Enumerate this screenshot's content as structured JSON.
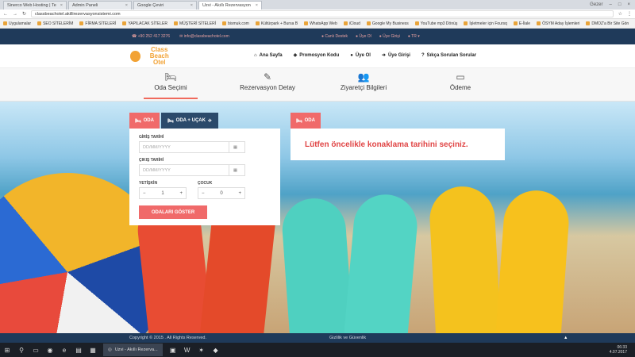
{
  "browser": {
    "tabs": [
      {
        "label": "Sinerco Web Hosting | Te",
        "active": false
      },
      {
        "label": "Admin Paneli",
        "active": false
      },
      {
        "label": "Google Çeviri",
        "active": false
      },
      {
        "label": "Uzvi - Akıllı Rezervasyon",
        "active": true
      }
    ],
    "profile": "Gezer",
    "url": "classbeachotel.akillirezervasyonsistemi.com",
    "bookmarks": [
      "Uygulamalar",
      "SEO SİTELERİM",
      "FİRMA SİTELERİ",
      "YAPILACAK SİTELER",
      "MÜŞTERİ SİTELERİ",
      "bismuk.com",
      "Kültürpark + Bursa B",
      "WhatsApp Web",
      "iCloud",
      "Google My Business",
      "YouTube mp3 Dönüş",
      "İşletmeler için Foursq",
      "E-İlale",
      "ÖSYM Aday İşlemleri",
      "DMOZ'a Bir Site Gön"
    ]
  },
  "topbar": {
    "phone": "+90 252 417 3276",
    "email": "info@classbeachotel.com",
    "live_support": "Canlı Destek",
    "signup": "Üye Ol",
    "login": "Üye Girişi",
    "lang": "TR"
  },
  "brand": {
    "line1": "Class Beach",
    "line2": "Otel"
  },
  "menu": {
    "home": "Ana Sayfa",
    "promo": "Promosyon Kodu",
    "member": "Üye Ol",
    "member_login": "Üye Girişi",
    "faq": "Sıkça Sorulan Sorular"
  },
  "steps": [
    {
      "label": "Oda Seçimi",
      "icon": "bed-icon",
      "active": true
    },
    {
      "label": "Rezervasyon Detay",
      "icon": "edit-icon",
      "active": false
    },
    {
      "label": "Ziyaretçi Bilgileri",
      "icon": "users-icon",
      "active": false
    },
    {
      "label": "Ödeme",
      "icon": "credit-card-icon",
      "active": false
    }
  ],
  "booking": {
    "tab_room": "ODA",
    "tab_room_flight": "ODA + UÇAK",
    "checkin_label": "GİRİŞ TARİHİ",
    "checkin_placeholder": "DD/MM/YYYY",
    "checkout_label": "ÇIKIŞ TARİHİ",
    "checkout_placeholder": "DD/MM/YYYY",
    "adult_label": "YETİŞKİN",
    "adult_value": "1",
    "child_label": "ÇOCUK",
    "child_value": "0",
    "submit": "ODALARI GÖSTER"
  },
  "notice": {
    "tab": "ODA",
    "message": "Lütfen öncelikle konaklama tarihini seçiniz."
  },
  "footer": {
    "copyright": "Copyright © 2015 . All Rights Reserved.",
    "privacy": "Gizlilik ve Güvenlik",
    "back_top": "▲"
  },
  "taskbar": {
    "active_app": "Uzvi - Akıllı Rezerva...",
    "time": "06:33",
    "date": "4.07.2017"
  }
}
